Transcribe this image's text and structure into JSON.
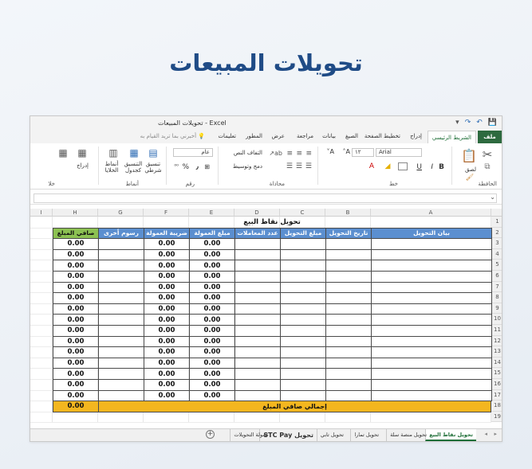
{
  "page": {
    "title": "تحويلات المبيعات"
  },
  "window": {
    "doc_title": "تحويلات المبيعات  -  Excel",
    "qa": {
      "save": "💾",
      "undo": "↶",
      "redo": "↷",
      "customize": "▾"
    }
  },
  "ribbon_tabs": {
    "file": "ملف",
    "home": "الشريط الرئيسي",
    "insert": "إدراج",
    "layout": "تخطيط الصفحة",
    "formulas": "الصيغ",
    "data": "بيانات",
    "review": "مراجعة",
    "view": "عرض",
    "developer": "المطور",
    "help": "تعليمات",
    "tell_me": "أخبرني بما تريد القيام به"
  },
  "ribbon": {
    "groups": {
      "clipboard": "الحافظة",
      "font": "خط",
      "alignment": "محاذاة",
      "number": "رقم",
      "styles": "أنماط",
      "cells": "خلا"
    },
    "paste": "لصق",
    "font_name": "Arial",
    "font_size": "١٢",
    "wrap_text": "التفاف النص",
    "merge_center": "دمج وتوسيط",
    "number_format": "عام",
    "conditional_formatting": "تنسيق شرطي",
    "format_as_table": "التنسيق كجدول",
    "cell_styles": "أنماط الخلايا",
    "insert": "إدراج",
    "bold": "B",
    "italic": "I",
    "underline": "U",
    "percent": "%",
    "comma": "٫"
  },
  "grid": {
    "columns": [
      "A",
      "B",
      "C",
      "D",
      "E",
      "F",
      "G",
      "H",
      "I"
    ],
    "rows": [
      "1",
      "2",
      "3",
      "4",
      "5",
      "6",
      "7",
      "8",
      "9",
      "10",
      "11",
      "12",
      "13",
      "14",
      "15",
      "16",
      "17",
      "18",
      "19"
    ],
    "sheet_title": "تحويل نقاط البيع",
    "headers": {
      "A": "بيان التحويل",
      "B": "تاريخ التحويل",
      "C": "مبلغ التحويل",
      "D": "عدد المعاملات",
      "E": "مبلغ العمولة",
      "F": "ضريبة العمولة",
      "G": "رسوم أخرى",
      "H": "صافي المبلغ"
    },
    "data_rows": [
      {
        "E": "0.00",
        "F": "0.00",
        "H": "0.00"
      },
      {
        "E": "0.00",
        "F": "0.00",
        "H": "0.00"
      },
      {
        "E": "0.00",
        "F": "0.00",
        "H": "0.00"
      },
      {
        "E": "0.00",
        "F": "0.00",
        "H": "0.00"
      },
      {
        "E": "0.00",
        "F": "0.00",
        "H": "0.00"
      },
      {
        "E": "0.00",
        "F": "0.00",
        "H": "0.00"
      },
      {
        "E": "0.00",
        "F": "0.00",
        "H": "0.00"
      },
      {
        "E": "0.00",
        "F": "0.00",
        "H": "0.00"
      },
      {
        "E": "0.00",
        "F": "0.00",
        "H": "0.00"
      },
      {
        "E": "0.00",
        "F": "0.00",
        "H": "0.00"
      },
      {
        "E": "0.00",
        "F": "0.00",
        "H": "0.00"
      },
      {
        "E": "0.00",
        "F": "0.00",
        "H": "0.00"
      },
      {
        "E": "0.00",
        "F": "0.00",
        "H": "0.00"
      },
      {
        "E": "0.00",
        "F": "0.00",
        "H": "0.00"
      },
      {
        "E": "0.00",
        "F": "0.00",
        "H": "0.00"
      }
    ],
    "total": {
      "label": "إجمالي صافي المبلغ",
      "value": "0.00"
    }
  },
  "sheet_tabs": [
    "تحويل نقاط البيع",
    "تحويل منصة سلة",
    "تحويل تمارا",
    "تحويل تابي",
    "تحويل STC Pay",
    "عمولة التحويلات"
  ],
  "colors": {
    "header_blue": "#5b8fd0",
    "header_green": "#8cc152",
    "total_orange": "#f3b61f",
    "title_blue": "#1f4b86",
    "excel_green": "#2d6a3f"
  }
}
